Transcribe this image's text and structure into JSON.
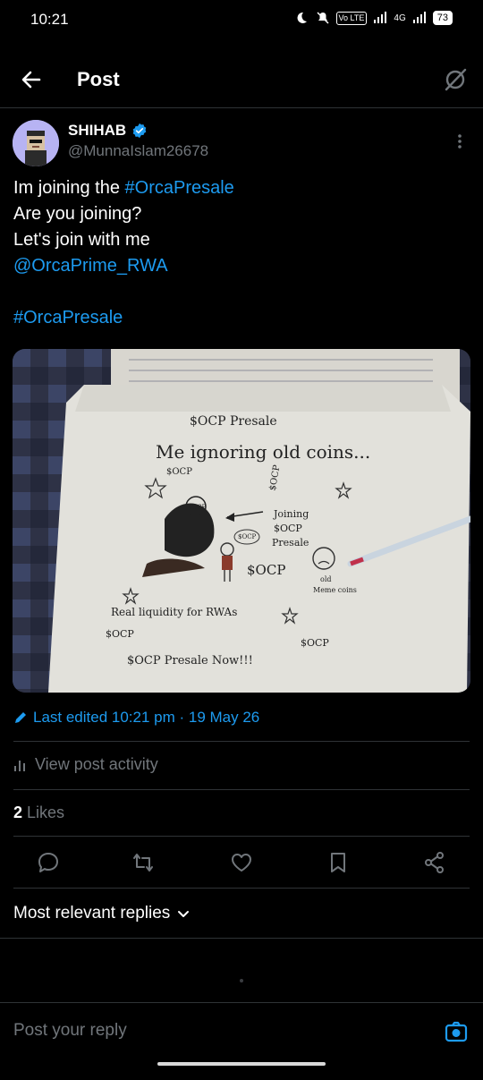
{
  "status_bar": {
    "time": "10:21",
    "volte": "Vo LTE",
    "network": "4G",
    "battery": "73"
  },
  "header": {
    "title": "Post"
  },
  "tweet": {
    "author_name": "SHIHAB",
    "handle": "@MunnaIslam26678",
    "text_lines": [
      {
        "plain": "Im joining the ",
        "link": "#OrcaPresale"
      },
      {
        "plain": "Are you joining?",
        "link": ""
      },
      {
        "plain": "Let's join with me",
        "link": ""
      },
      {
        "plain": "",
        "link": "@OrcaPrime_RWA"
      },
      {
        "plain": "",
        "link": ""
      },
      {
        "plain": "",
        "link": "#OrcaPresale"
      }
    ],
    "image_text": {
      "title": "$OCP Presale",
      "headline": "Me ignoring old coins...",
      "left_tag": "$OCP",
      "vertical_tag": "$OCP",
      "coin_label": "$OCP",
      "bubble": "$OCP",
      "joining_1": "Joining",
      "joining_2": "$OCP",
      "joining_3": "Presale",
      "mid_ocp": "$OCP",
      "old_1": "old",
      "old_2": "Meme coins",
      "real": "Real liquidity for RWAs",
      "bottom_left": "$OCP",
      "bottom_right": "$OCP",
      "bottom": "$OCP Presale  Now!!!"
    },
    "edited": "Last edited 10:21 pm · 19 May 26",
    "view_activity": "View post activity",
    "likes_count": "2",
    "likes_label": " Likes"
  },
  "replies": {
    "sort_label": "Most relevant replies",
    "placeholder": "Post your reply"
  },
  "colors": {
    "accent": "#1d9bf0",
    "muted": "#71767b",
    "divider": "#2f3336"
  }
}
